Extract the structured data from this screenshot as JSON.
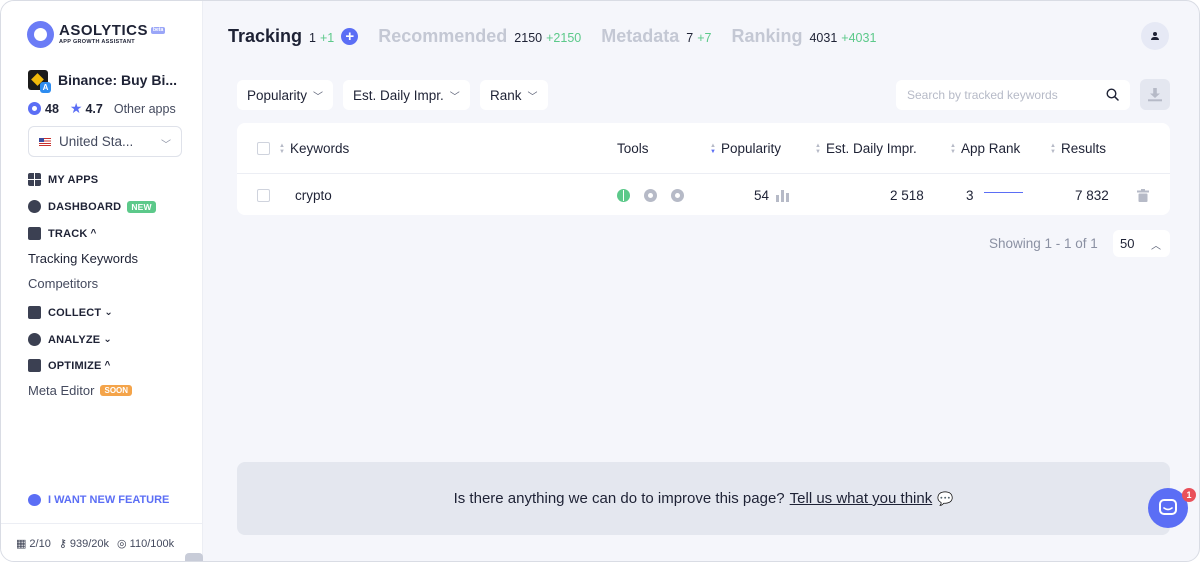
{
  "brand": {
    "name": "ASOLYTICS",
    "badge": "beta",
    "tagline": "APP GROWTH ASSISTANT"
  },
  "app": {
    "name": "Binance: Buy Bi...",
    "apps_count": "48",
    "rating": "4.7",
    "other_apps_label": "Other apps"
  },
  "country": {
    "selected": "United Sta..."
  },
  "nav": {
    "my_apps": "MY APPS",
    "dashboard": "DASHBOARD",
    "dashboard_badge": "NEW",
    "track": "TRACK",
    "tracking_keywords": "Tracking Keywords",
    "competitors": "Competitors",
    "collect": "COLLECT",
    "analyze": "ANALYZE",
    "optimize": "OPTIMIZE",
    "meta_editor": "Meta Editor",
    "meta_editor_badge": "SOON",
    "feature_request": "I WANT NEW FEATURE"
  },
  "usage": {
    "apps": "2/10",
    "keywords": "939/20k",
    "results": "110/100k"
  },
  "tabs": [
    {
      "label": "Tracking",
      "count": "1",
      "delta": "+1"
    },
    {
      "label": "Recommended",
      "count": "2150",
      "delta": "+2150"
    },
    {
      "label": "Metadata",
      "count": "7",
      "delta": "+7"
    },
    {
      "label": "Ranking",
      "count": "4031",
      "delta": "+4031"
    }
  ],
  "filters": {
    "popularity": "Popularity",
    "est_daily": "Est. Daily Impr.",
    "rank": "Rank"
  },
  "search": {
    "placeholder": "Search by tracked keywords"
  },
  "table": {
    "headers": {
      "keywords": "Keywords",
      "tools": "Tools",
      "popularity": "Popularity",
      "est_daily": "Est. Daily Impr.",
      "app_rank": "App Rank",
      "results": "Results"
    },
    "rows": [
      {
        "keyword": "crypto",
        "popularity": "54",
        "est_daily": "2 518",
        "app_rank": "3",
        "results": "7 832"
      }
    ]
  },
  "pagination": {
    "showing": "Showing 1 - 1 of 1",
    "per_page": "50"
  },
  "feedback": {
    "question": "Is there anything we can do to improve this page?",
    "link": "Tell us what you think"
  },
  "chat": {
    "unread": "1"
  },
  "colors": {
    "accent": "#5b6ef5",
    "positive": "#5cc98a",
    "soon": "#f4a44a",
    "alert": "#e9505a"
  }
}
